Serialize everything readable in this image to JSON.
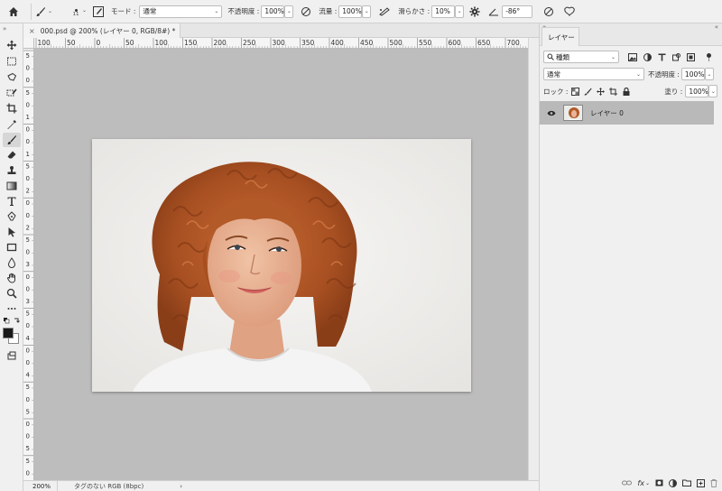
{
  "options_bar": {
    "brush_size": "11",
    "mode_label": "モード :",
    "mode_value": "通常",
    "opacity_label": "不透明度 :",
    "opacity_value": "100%",
    "flow_label": "流量 :",
    "flow_value": "100%",
    "smoothing_label": "滑らかさ :",
    "smoothing_value": "10%",
    "angle_value": "-86°"
  },
  "document_tab": {
    "close": "×",
    "title": "000.psd @ 200% (レイヤー 0, RGB/8#) *"
  },
  "ruler": {
    "h_labels": [
      "100",
      "50",
      "0",
      "50",
      "100",
      "150",
      "200",
      "250",
      "300",
      "350",
      "400",
      "450",
      "500",
      "550",
      "600",
      "650",
      "700"
    ],
    "v_labels": [
      "5",
      "0",
      "0",
      "5",
      "0",
      "1",
      "0",
      "0",
      "1",
      "5",
      "0",
      "2",
      "0",
      "0",
      "2",
      "5",
      "0",
      "3",
      "0",
      "0",
      "3",
      "5",
      "0",
      "4",
      "0",
      "0",
      "4",
      "5",
      "0",
      "5",
      "0",
      "0",
      "5",
      "5",
      "0"
    ]
  },
  "status_bar": {
    "zoom": "200%",
    "info": "タグのない RGB (8bpc)",
    "arrow": "›"
  },
  "layers_panel": {
    "tab_label": "レイヤー",
    "filter_value": "種類",
    "blend_mode": "通常",
    "opacity_label": "不透明度 :",
    "opacity_value": "100%",
    "lock_label": "ロック :",
    "fill_label": "塗り :",
    "fill_value": "100%",
    "layers": [
      {
        "name": "レイヤー 0",
        "visible": true
      }
    ]
  },
  "colors": {
    "selected_layer": "#b9b9b9",
    "canvas_bg": "#bdbdbd",
    "foreground": "#1a1a1a",
    "background": "#ffffff"
  }
}
